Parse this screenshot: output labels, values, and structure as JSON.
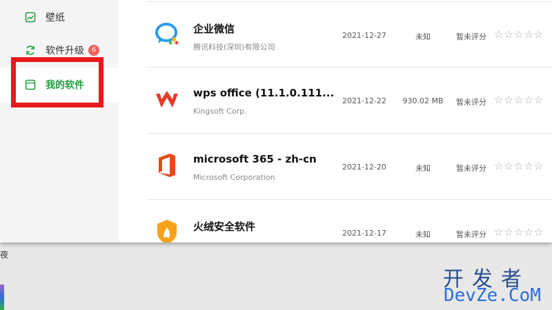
{
  "sidebar": {
    "items": [
      {
        "label": "壁纸",
        "icon": "wallpaper-icon"
      },
      {
        "label": "软件升级",
        "icon": "refresh-icon",
        "badge": "6"
      },
      {
        "label": "我的软件",
        "icon": "my-software-icon",
        "active": true
      }
    ]
  },
  "apps": [
    {
      "name": "企业微信",
      "vendor": "腾讯科技(深圳)有限公司",
      "date": "2021-12-27",
      "size": "未知",
      "rating": "暂未评分",
      "stars": "☆☆☆☆☆",
      "icon": "wecom-icon"
    },
    {
      "name": "wps office (11.1.0.111...",
      "vendor": "Kingsoft Corp.",
      "date": "2021-12-22",
      "size": "930.02 MB",
      "rating": "暂未评分",
      "stars": "☆☆☆☆☆",
      "icon": "wps-icon"
    },
    {
      "name": "microsoft 365 - zh-cn",
      "vendor": "Microsoft Corporation",
      "date": "2021-12-20",
      "size": "未知",
      "rating": "暂未评分",
      "stars": "☆☆☆☆☆",
      "icon": "office-icon"
    },
    {
      "name": "火绒安全软件",
      "vendor": "",
      "date": "2021-12-17",
      "size": "未知",
      "rating": "暂未评分",
      "stars": "☆☆☆☆☆",
      "icon": "huorong-icon"
    }
  ],
  "desktop": {
    "fragment": "夜"
  },
  "watermark": {
    "cn": "开发者",
    "en": "DevZe.CoM"
  },
  "colors": {
    "accent": "#1f9d3e",
    "highlight": "#e8191e",
    "badge": "#f0605a"
  }
}
